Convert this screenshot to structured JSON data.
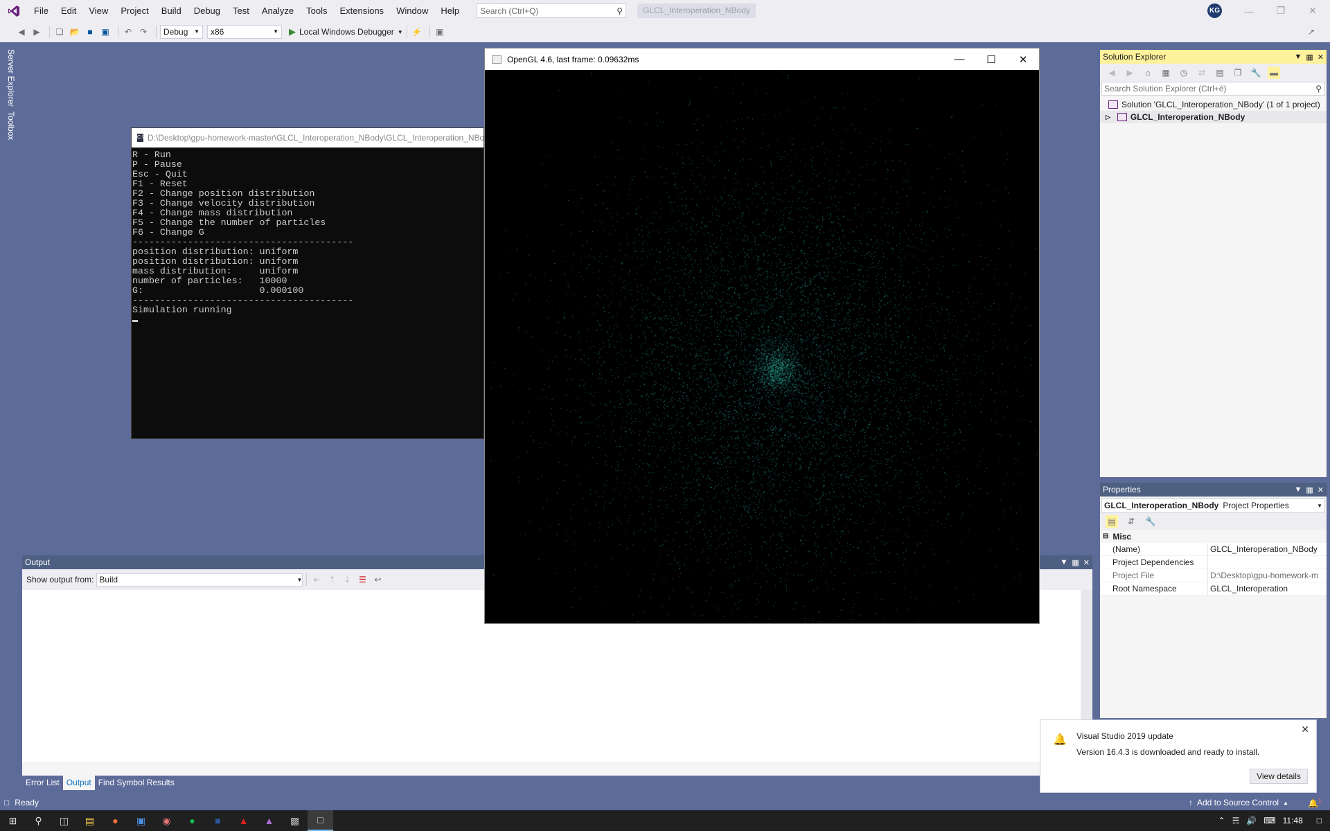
{
  "menubar": {
    "items": [
      "File",
      "Edit",
      "View",
      "Project",
      "Build",
      "Debug",
      "Test",
      "Analyze",
      "Tools",
      "Extensions",
      "Window",
      "Help"
    ],
    "search_placeholder": "Search (Ctrl+Q)",
    "solution_title": "GLCL_Interoperation_NBody",
    "avatar_initials": "KG"
  },
  "toolbar": {
    "configuration": "Debug",
    "platform": "x86",
    "debugger_label": "Local Windows Debugger"
  },
  "left_tabs": [
    "Server Explorer",
    "Toolbox"
  ],
  "console": {
    "title": "D:\\Desktop\\gpu-homework-master\\GLCL_Interoperation_NBody\\GLCL_Interoperation_NBody",
    "icon_text": "C:\\",
    "lines": [
      "R - Run",
      "P - Pause",
      "Esc - Quit",
      "F1 - Reset",
      "F2 - Change position distribution",
      "F3 - Change velocity distribution",
      "F4 - Change mass distribution",
      "F5 - Change the number of particles",
      "F6 - Change G",
      "----------------------------------------",
      "position distribution: uniform",
      "position distribution: uniform",
      "mass distribution:     uniform",
      "number of particles:   10000",
      "G:                     0.000100",
      "----------------------------------------",
      "Simulation running"
    ]
  },
  "gl_window": {
    "title": "OpenGL 4.6, last frame: 0.09632ms",
    "particle_color": "#2fb5a8",
    "particle_count": 10000
  },
  "solution_explorer": {
    "title": "Solution Explorer",
    "search_placeholder": "Search Solution Explorer (Ctrl+é)",
    "solution_label": "Solution 'GLCL_Interoperation_NBody' (1 of 1 project)",
    "project_label": "GLCL_Interoperation_NBody"
  },
  "properties": {
    "title": "Properties",
    "object_name": "GLCL_Interoperation_NBody",
    "object_type": "Project Properties",
    "category": "Misc",
    "rows": [
      {
        "name": "(Name)",
        "value": "GLCL_Interoperation_NBody"
      },
      {
        "name": "Project Dependencies",
        "value": ""
      },
      {
        "name": "Project File",
        "value": "D:\\Desktop\\gpu-homework-m"
      },
      {
        "name": "Root Namespace",
        "value": "GLCL_Interoperation"
      }
    ]
  },
  "output": {
    "title": "Output",
    "show_from_label": "Show output from:",
    "source": "Build"
  },
  "bottom_tabs": [
    "Error List",
    "Output",
    "Find Symbol Results"
  ],
  "notification": {
    "title": "Visual Studio 2019 update",
    "body": "Version 16.4.3 is downloaded and ready to install.",
    "button": "View details"
  },
  "statusbar": {
    "status": "Ready",
    "source_control": "Add to Source Control",
    "notification_count": "1"
  },
  "taskbar": {
    "time": "11:48"
  },
  "colors": {
    "accent_yellow": "#fff29d",
    "vs_blue": "#5d6b99",
    "console_bg": "#0c0c0c"
  }
}
